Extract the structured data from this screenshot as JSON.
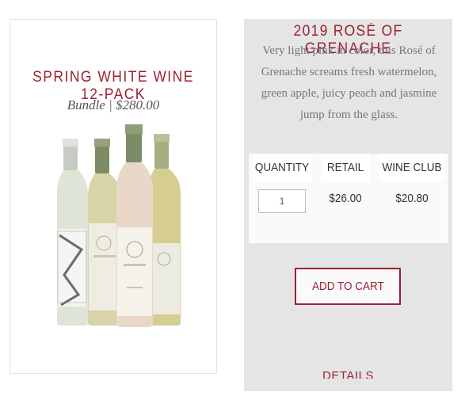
{
  "bundle": {
    "title": "SPRING WHITE WINE 12-PACK",
    "subtitle": "Bundle | $280.00",
    "image_icon": "wine-bottles-image"
  },
  "wine": {
    "title": "2019 ROSÉ OF GRENACHE",
    "description": "Very light pink in color, this Rosé of Grenache screams fresh watermelon, green apple, juicy peach and jasmine jump from the glass."
  },
  "price_table": {
    "headers": {
      "quantity": "QUANTITY",
      "retail": "RETAIL",
      "club": "WINE CLUB"
    },
    "quantity_value": "1",
    "retail_price": "$26.00",
    "club_price": "$20.80"
  },
  "actions": {
    "add_to_cart": "ADD TO CART",
    "details": "DETAILS"
  },
  "colors": {
    "accent": "#a01e32",
    "panel": "#e5e5e5"
  }
}
